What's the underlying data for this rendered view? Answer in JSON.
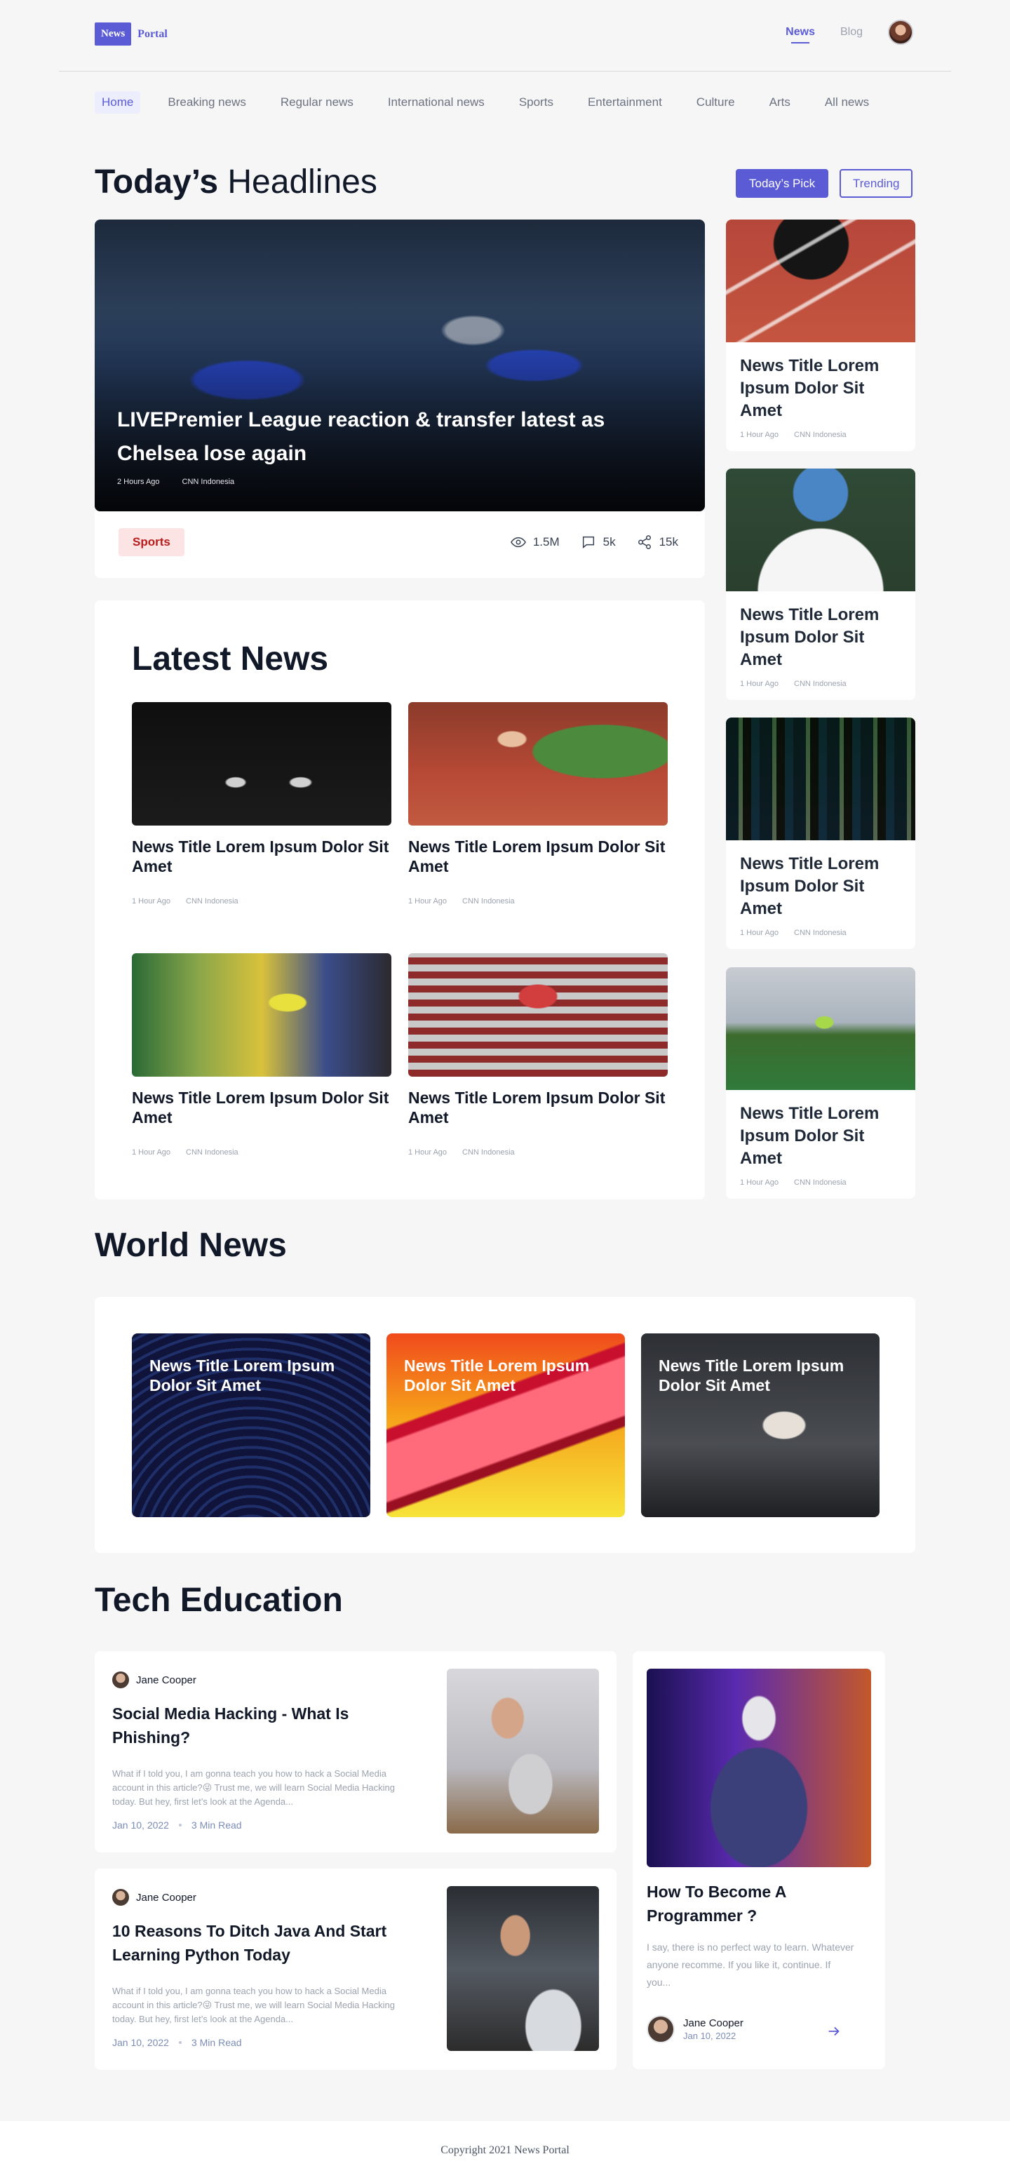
{
  "brand": {
    "box": "News",
    "text": "Portal"
  },
  "topnav": {
    "news": "News",
    "blog": "Blog"
  },
  "categories": [
    "Home",
    "Breaking news",
    "Regular news",
    "International news",
    "Sports",
    "Entertainment",
    "Culture",
    "Arts",
    "All news"
  ],
  "headlines": {
    "title_bold": "Today’s",
    "title_light": "Headlines",
    "todays_pick": "Today’s Pick",
    "trending": "Trending",
    "hero": {
      "title": "LIVEPremier League reaction & transfer latest as Chelsea lose again",
      "time": "2 Hours Ago",
      "source": "CNN Indonesia",
      "tag": "Sports",
      "views": "1.5M",
      "comments": "5k",
      "shares": "15k"
    },
    "side": [
      {
        "title": "News Title Lorem Ipsum Dolor Sit Amet",
        "time": "1 Hour Ago",
        "source": "CNN Indonesia"
      },
      {
        "title": "News Title Lorem Ipsum Dolor Sit Amet",
        "time": "1 Hour Ago",
        "source": "CNN Indonesia"
      },
      {
        "title": "News Title Lorem Ipsum Dolor Sit Amet",
        "time": "1 Hour Ago",
        "source": "CNN Indonesia"
      },
      {
        "title": "News Title Lorem Ipsum Dolor Sit Amet",
        "time": "1 Hour Ago",
        "source": "CNN Indonesia"
      }
    ]
  },
  "latest": {
    "title": "Latest News",
    "items": [
      {
        "title": "News Title Lorem Ipsum Dolor Sit Amet",
        "time": "1 Hour Ago",
        "source": "CNN Indonesia"
      },
      {
        "title": "News Title Lorem Ipsum Dolor Sit Amet",
        "time": "1 Hour Ago",
        "source": "CNN Indonesia"
      },
      {
        "title": "News Title Lorem Ipsum Dolor Sit Amet",
        "time": "1 Hour Ago",
        "source": "CNN Indonesia"
      },
      {
        "title": "News Title Lorem Ipsum Dolor Sit Amet",
        "time": "1 Hour Ago",
        "source": "CNN Indonesia"
      }
    ]
  },
  "world": {
    "title": "World News",
    "items": [
      {
        "title": "News Title Lorem Ipsum Dolor Sit Amet"
      },
      {
        "title": "News Title Lorem Ipsum Dolor Sit Amet"
      },
      {
        "title": "News Title Lorem Ipsum Dolor Sit Amet"
      }
    ]
  },
  "tech": {
    "title": "Tech Education",
    "articles": [
      {
        "author": "Jane Cooper",
        "title": "Social Media Hacking - What Is Phishing?",
        "desc": "What if I told you, I am gonna teach you how to hack a Social Media account in this article?😜 Trust me, we will learn Social Media Hacking today. But hey, first let’s look at the Agenda...",
        "date": "Jan 10, 2022",
        "read": "3 Min Read"
      },
      {
        "author": "Jane Cooper",
        "title": "10 Reasons To Ditch Java And Start Learning Python Today",
        "desc": "What if I told you, I am gonna teach you how to hack a Social Media account in this article?😜 Trust me, we will learn Social Media Hacking today. But hey, first let’s look at the Agenda...",
        "date": "Jan 10, 2022",
        "read": "3 Min Read"
      }
    ],
    "featured": {
      "title": "How To Become A Programmer ?",
      "desc": "I say, there is no perfect way to learn. Whatever anyone recomme. If you like it, continue. If you...",
      "author": "Jane Cooper",
      "date": "Jan 10, 2022"
    }
  },
  "footer": "Copyright 2021 News Portal"
}
